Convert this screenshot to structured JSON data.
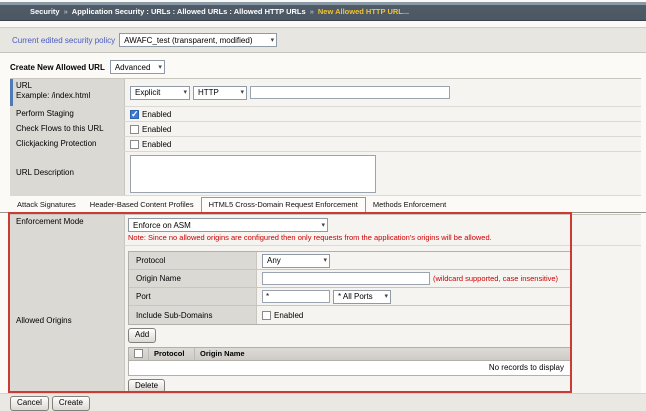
{
  "breadcrumb": {
    "section": "Security",
    "separator": "»",
    "path": "Application Security : URLs : Allowed URLs : Allowed HTTP URLs",
    "current": "New Allowed HTTP URL..."
  },
  "policy_bar": {
    "label": "Current edited security policy",
    "selected": "AWAFC_test (transparent, modified)"
  },
  "create_header": {
    "title": "Create New Allowed URL",
    "mode_selected": "Advanced"
  },
  "form": {
    "url_row": {
      "label_line1": "URL",
      "label_line2": "Example: /index.html",
      "type_selected": "Explicit",
      "protocol_selected": "HTTP",
      "url_value": ""
    },
    "perform_staging": {
      "label": "Perform Staging",
      "checkbox_label": "Enabled",
      "checked": true
    },
    "check_flows": {
      "label": "Check Flows to this URL",
      "checkbox_label": "Enabled",
      "checked": false
    },
    "clickjacking": {
      "label": "Clickjacking Protection",
      "checkbox_label": "Enabled",
      "checked": false
    },
    "url_description": {
      "label": "URL Description",
      "value": ""
    }
  },
  "tabs": [
    {
      "label": "Attack Signatures"
    },
    {
      "label": "Header-Based Content Profiles"
    },
    {
      "label": "HTML5 Cross-Domain Request Enforcement"
    },
    {
      "label": "Methods Enforcement"
    }
  ],
  "cross_domain": {
    "enforcement_mode": {
      "label": "Enforcement Mode",
      "selected": "Enforce on ASM",
      "note": "Note: Since no allowed origins are configured then only requests from the application's origins will be allowed."
    },
    "allowed_origins": {
      "label": "Allowed Origins",
      "protocol": {
        "label": "Protocol",
        "selected": "Any"
      },
      "origin_name": {
        "label": "Origin Name",
        "value": "",
        "hint": "(wildcard supported, case insensitive)"
      },
      "port": {
        "label": "Port",
        "value": "*",
        "selected": "* All Ports"
      },
      "include_subdomains": {
        "label": "Include Sub-Domains",
        "checkbox_label": "Enabled",
        "checked": false
      },
      "add_button": "Add",
      "table": {
        "col_protocol": "Protocol",
        "col_origin": "Origin Name",
        "empty_text": "No records to display"
      },
      "delete_button": "Delete"
    }
  },
  "footer": {
    "cancel": "Cancel",
    "create": "Create"
  }
}
